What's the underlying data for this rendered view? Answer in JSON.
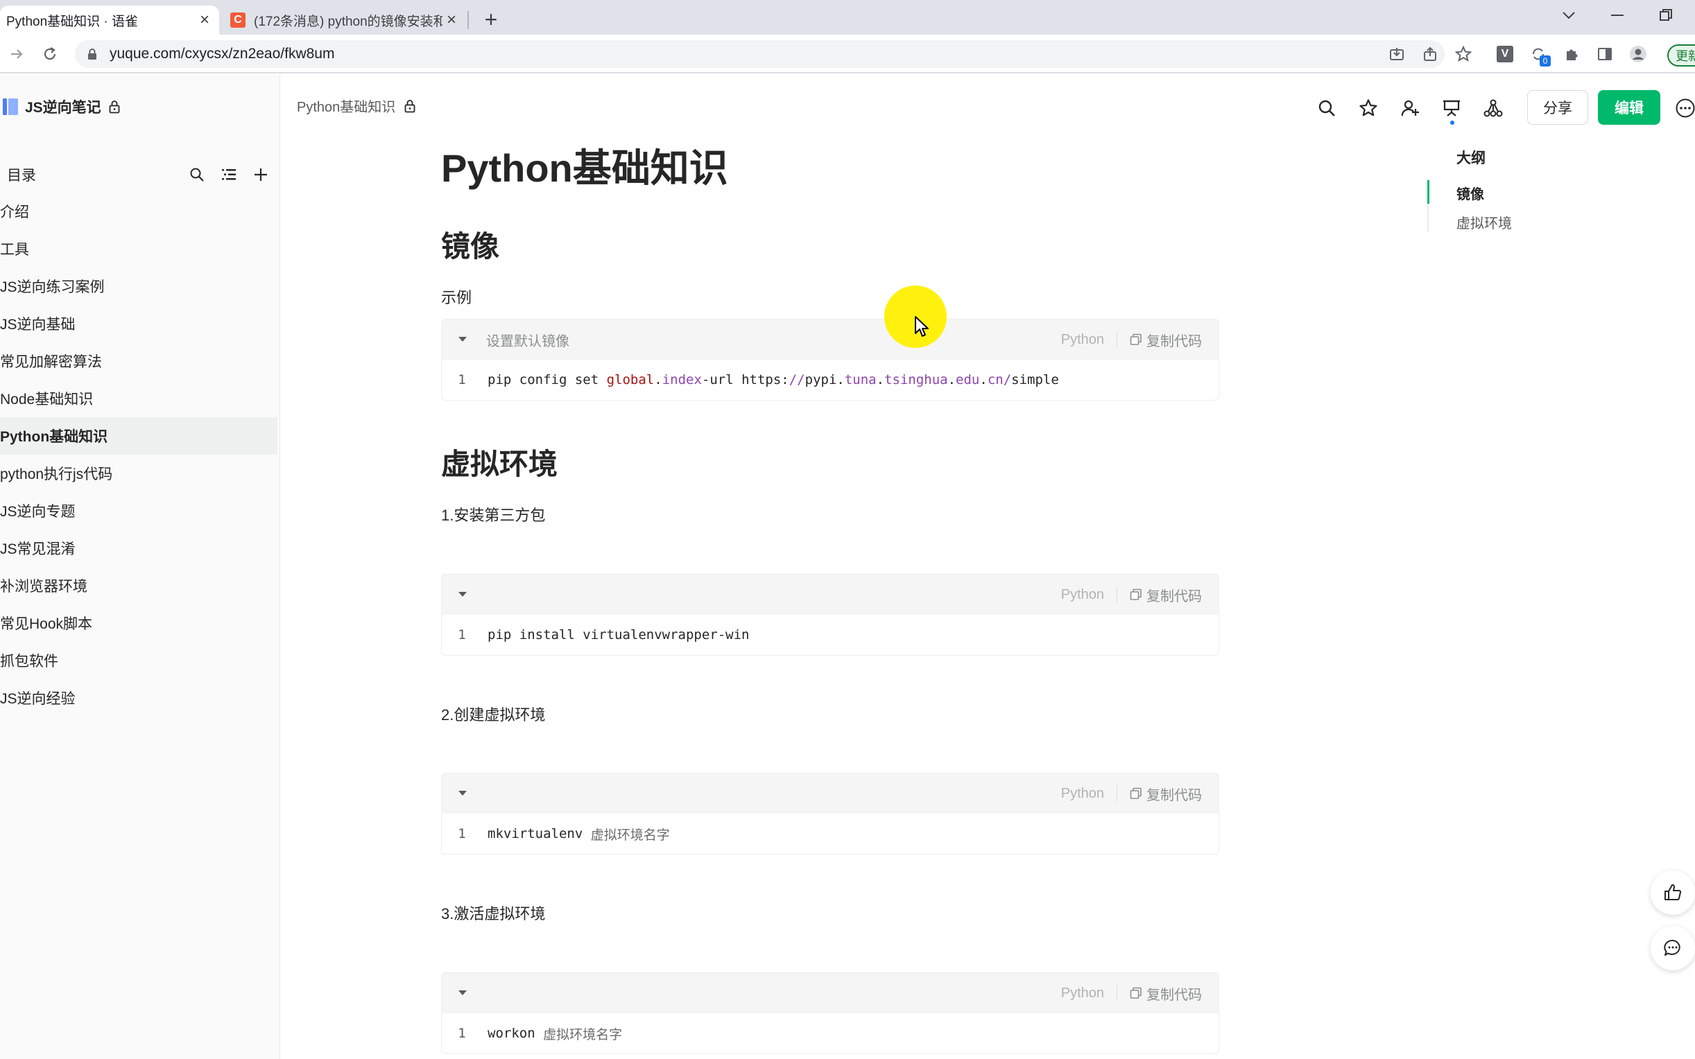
{
  "browser": {
    "tabs": [
      {
        "title": "Python基础知识 · 语雀",
        "active": true
      },
      {
        "title": "(172条消息) python的镜像安装和",
        "active": false,
        "favicon": "C"
      }
    ],
    "url": "yuque.com/cxycsx/zn2eao/fkw8um",
    "extension_badge": "0",
    "update_label": "更新"
  },
  "sidebar": {
    "book_title": "JS逆向笔记",
    "toc_label": "目录",
    "items": [
      {
        "label": "介绍"
      },
      {
        "label": "工具"
      },
      {
        "label": "JS逆向练习案例"
      },
      {
        "label": "JS逆向基础"
      },
      {
        "label": "常见加解密算法"
      },
      {
        "label": "Node基础知识"
      },
      {
        "label": "Python基础知识",
        "active": true
      },
      {
        "label": "python执行js代码"
      },
      {
        "label": "JS逆向专题"
      },
      {
        "label": "JS常见混淆"
      },
      {
        "label": "补浏览器环境"
      },
      {
        "label": "常见Hook脚本"
      },
      {
        "label": "抓包软件"
      },
      {
        "label": "JS逆向经验"
      }
    ]
  },
  "header": {
    "breadcrumb": "Python基础知识",
    "share_label": "分享",
    "edit_label": "编辑"
  },
  "doc": {
    "title": "Python基础知识",
    "section1": {
      "heading": "镜像",
      "para": "示例",
      "code": {
        "caption": "设置默认镜像",
        "lang": "Python",
        "copy_label": "复制代码",
        "line_no": "1",
        "tokens": [
          "pip config set ",
          "global",
          ".",
          "index",
          "-url https:",
          "//",
          "pypi",
          ".",
          "tuna",
          ".",
          "tsinghua",
          ".",
          "edu",
          ".",
          "cn",
          "/",
          "simple"
        ]
      }
    },
    "section2": {
      "heading": "虚拟环境",
      "step1": "1.安装第三方包",
      "code1": {
        "lang": "Python",
        "copy_label": "复制代码",
        "line_no": "1",
        "text": "pip install virtualenvwrapper-win"
      },
      "step2": "2.创建虚拟环境",
      "code2": {
        "lang": "Python",
        "copy_label": "复制代码",
        "line_no": "1",
        "text": "mkvirtualenv ",
        "comment": "虚拟环境名字"
      },
      "step3": "3.激活虚拟环境",
      "code3": {
        "lang": "Python",
        "copy_label": "复制代码",
        "line_no": "1",
        "text": "workon ",
        "comment": "虚拟环境名字"
      }
    }
  },
  "outline": {
    "title": "大纲",
    "items": [
      {
        "label": "镜像",
        "active": true
      },
      {
        "label": "虚拟环境"
      }
    ]
  },
  "colors": {
    "accent": "#00b96b",
    "cursor_highlight": "#fff000"
  }
}
